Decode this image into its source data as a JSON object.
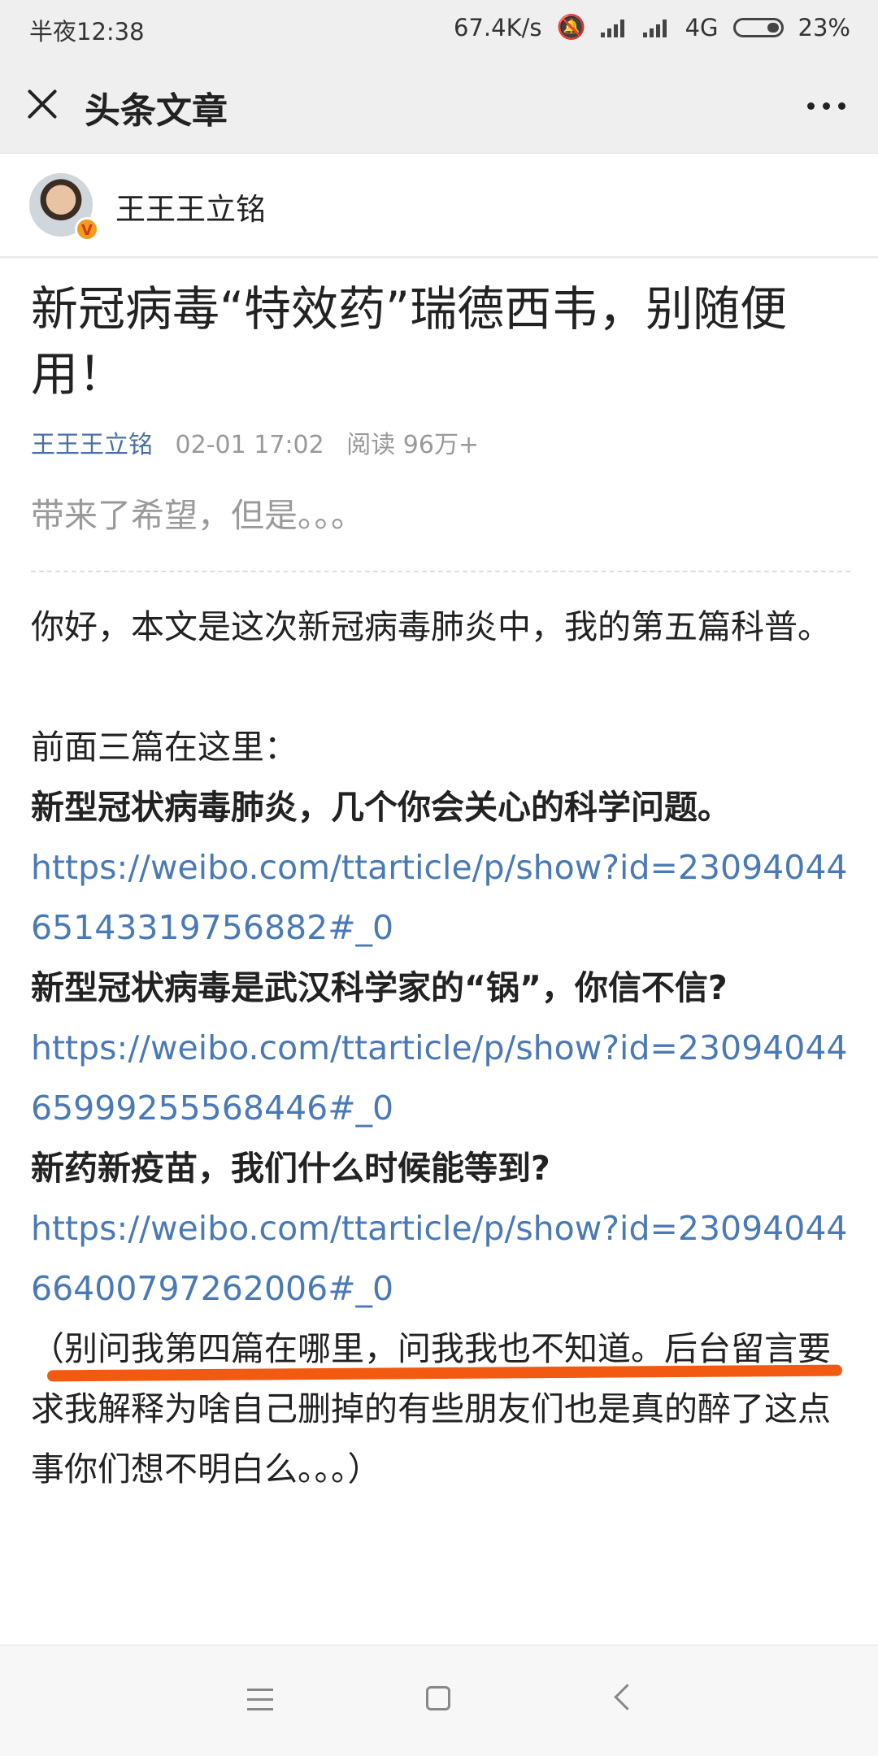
{
  "status": {
    "time": "半夜12:38",
    "speed": "67.4K/s",
    "network": "4G",
    "battery": "23%"
  },
  "header": {
    "title": "头条文章",
    "close_icon": "close-icon",
    "more_icon": "more-icon"
  },
  "author": {
    "name": "王王王立铭",
    "badge": "V"
  },
  "article": {
    "title": "新冠病毒“特效药”瑞德西韦，别随便用！",
    "meta_author": "王王王立铭",
    "meta_date": "02-01 17:02",
    "meta_reads": "阅读 96万+",
    "summary": "带来了希望，但是。。。",
    "intro": "你好，本文是这次新冠病毒肺炎中，我的第五篇科普。",
    "prev_heading": "前面三篇在这里：",
    "items": [
      {
        "title": "新型冠状病毒肺炎，几个你会关心的科学问题。",
        "url": "https://weibo.com/ttarticle/p/show?id=2309404465143319756882#_0"
      },
      {
        "title": "新型冠状病毒是武汉科学家的“锅”，你信不信?",
        "url": "https://weibo.com/ttarticle/p/show?id=2309404465999255568446#_0"
      },
      {
        "title": "新药新疫苗，我们什么时候能等到?",
        "url": "https://weibo.com/ttarticle/p/show?id=2309404466400797262006#_0"
      }
    ],
    "note": "（别问我第四篇在哪里，问我我也不知道。后台留言要求我解释为啥自己删掉的有些朋友们也是真的醉了这点事你们想不明白么。。。）"
  },
  "colors": {
    "link": "#4a7ab5",
    "highlight": "#f25a12",
    "chrome": "#efefef"
  }
}
